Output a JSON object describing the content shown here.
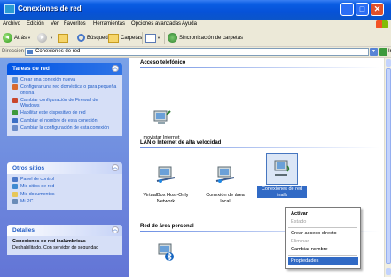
{
  "window": {
    "title": "Conexiones de red"
  },
  "menu": [
    "Archivo",
    "Edición",
    "Ver",
    "Favoritos",
    "Herramientas",
    "Opciones avanzadas",
    "Ayuda"
  ],
  "toolbar": {
    "back": "Atrás",
    "search": "Búsqueda",
    "folders": "Carpetas",
    "sync": "Sincronización de carpetas"
  },
  "address": {
    "label": "Dirección",
    "value": "Conexiones de red",
    "go": "Ir"
  },
  "sidebar": {
    "tasks": {
      "title": "Tareas de red",
      "items": [
        "Crear una conexión nueva",
        "Configurar una red doméstica o para pequeña oficina",
        "Cambiar configuración de Firewall de Windows",
        "Habilitar este dispositivo de red",
        "Cambiar el nombre de esta conexión",
        "Cambiar la configuración de esta conexión"
      ]
    },
    "other": {
      "title": "Otros sitios",
      "items": [
        "Panel de control",
        "Mis sitios de red",
        "Mis documentos",
        "Mi PC"
      ]
    },
    "details": {
      "title": "Detalles",
      "name": "Conexiones de red inalámbricas",
      "desc": "Deshabilitado, Con servidor de seguridad"
    }
  },
  "groups": [
    {
      "title": "Acceso telefónico",
      "items": [
        "movistar Internet"
      ]
    },
    {
      "title": "LAN o Internet de alta velocidad",
      "items": [
        "VirtualBox Host-Only Network",
        "Conexión de área local",
        "Conexiones de red inalá"
      ]
    },
    {
      "title": "Red de área personal",
      "items": [
        ""
      ]
    }
  ],
  "context_menu": {
    "items": [
      "Activar",
      "Estado",
      "Crear acceso directo",
      "Eliminar",
      "Cambiar nombre",
      "Propiedades"
    ]
  },
  "colors": {
    "accent": "#316ac5",
    "sidebar": "#7ba2e7",
    "link": "#215dc6"
  }
}
